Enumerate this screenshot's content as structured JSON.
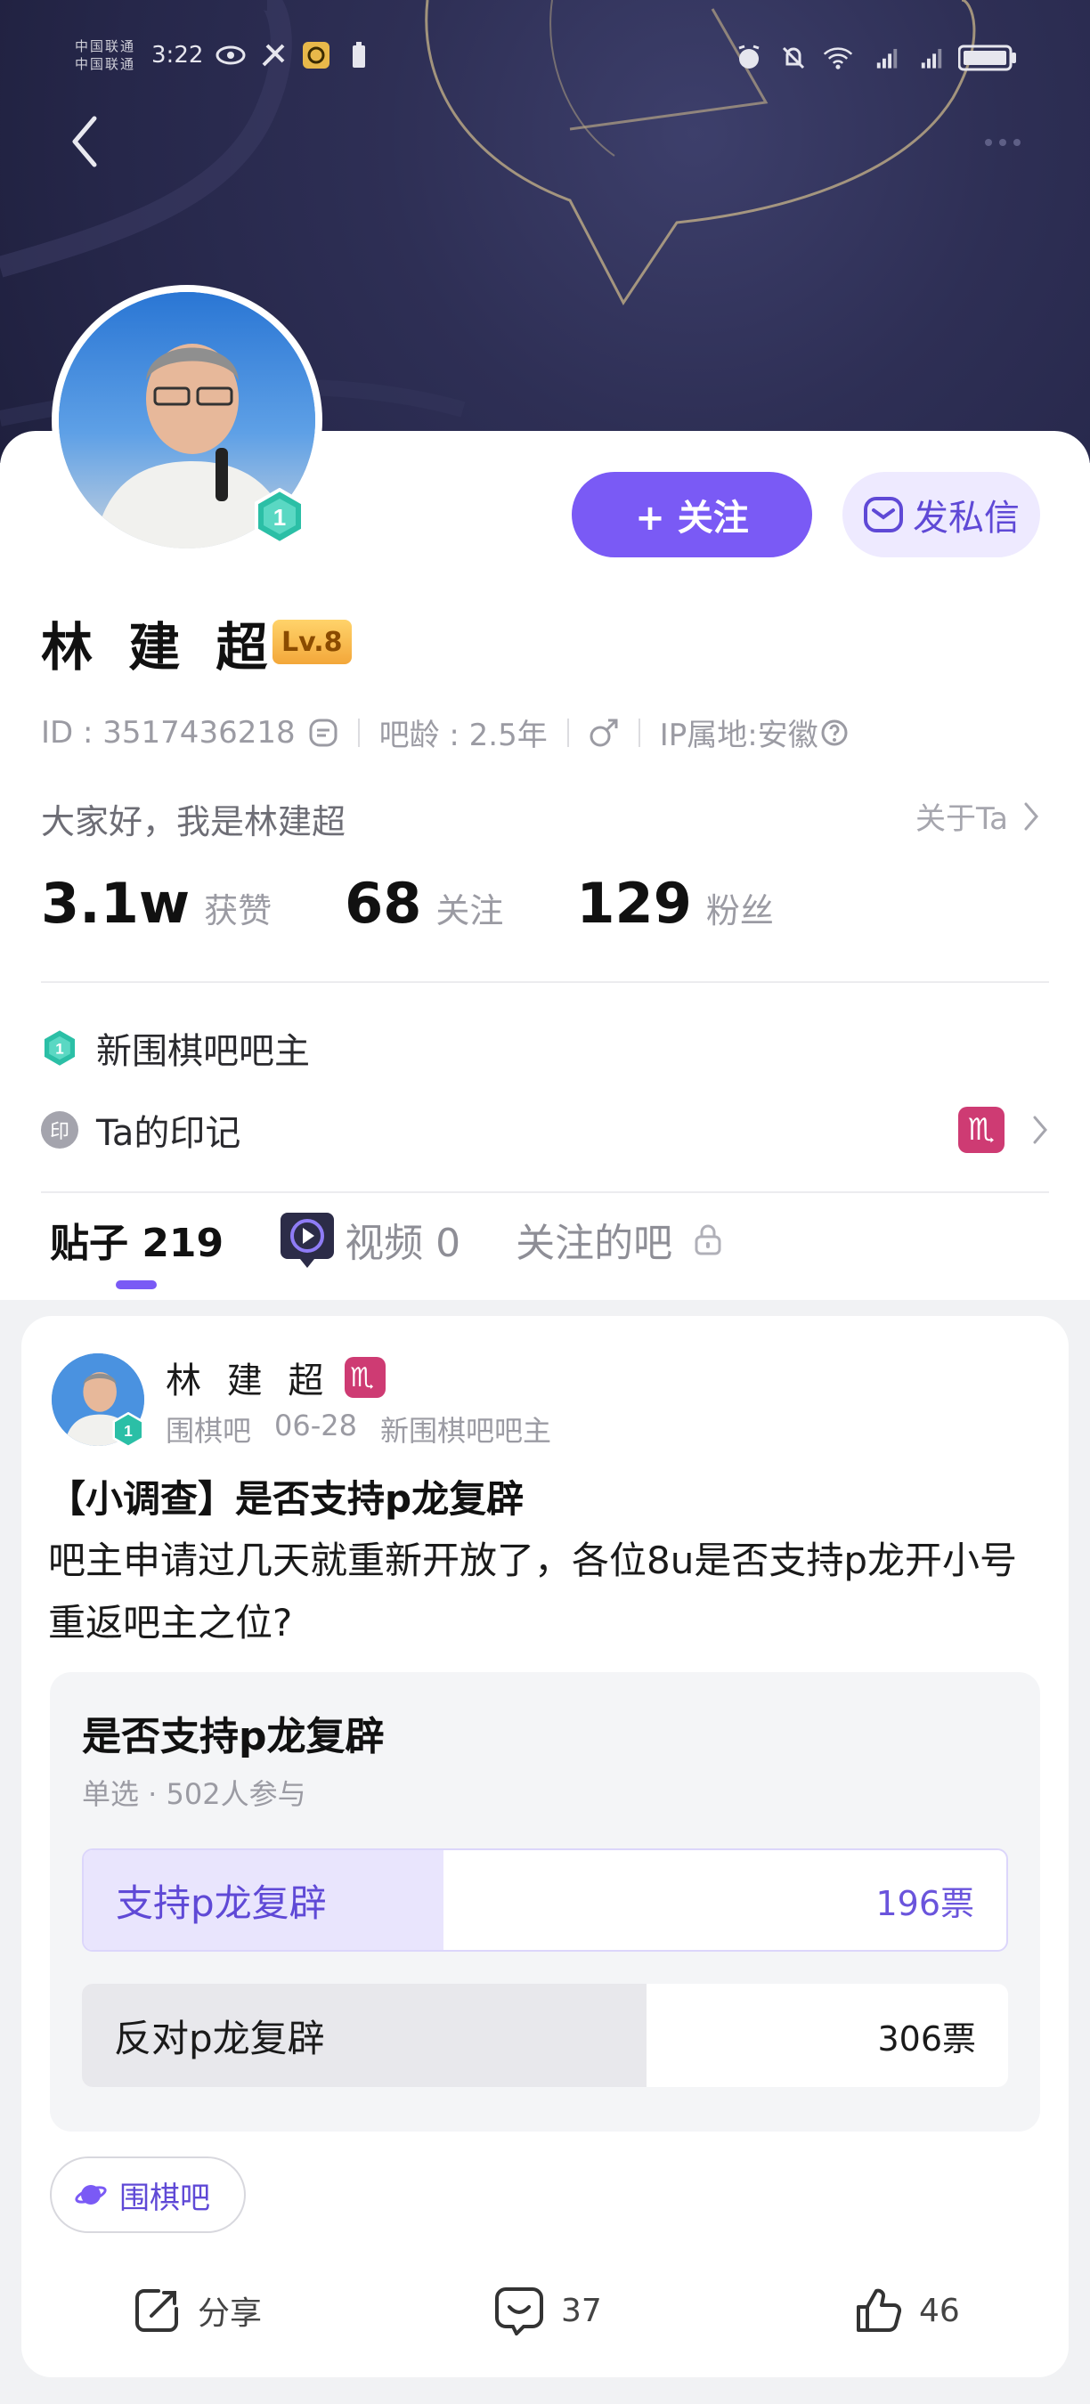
{
  "status_bar": {
    "carrier_1": "中国联通",
    "carrier_2": "中国联通",
    "time": "3:22",
    "battery": "100"
  },
  "profile": {
    "name": "林 建 超",
    "level": "Lv.8",
    "id_text": "ID : 3517436218",
    "age_text": "吧龄 : 2.5年",
    "ip_text": "IP属地:安徽",
    "intro": "大家好，我是林建超",
    "about_link": "关于Ta",
    "follow_label": "+ 关注",
    "dm_label": "发私信",
    "avatar_badge_number": "1",
    "stats": [
      {
        "num": "3.1w",
        "label": "获赞"
      },
      {
        "num": "68",
        "label": "关注"
      },
      {
        "num": "129",
        "label": "粉丝"
      }
    ],
    "role": "新围棋吧吧主",
    "mark_label": "Ta的印记",
    "mark_icon_char": "印"
  },
  "tabs": [
    {
      "label": "贴子 219"
    },
    {
      "label": "视频 0"
    },
    {
      "label": "关注的吧"
    }
  ],
  "post": {
    "author": "林 建 超",
    "forum": "围棋吧",
    "date": "06-28",
    "role": "新围棋吧吧主",
    "title": "【小调查】是否支持p龙复辟",
    "body": "吧主申请过几天就重新开放了，各位8u是否支持p龙开小号重返吧主之位?",
    "poll": {
      "title": "是否支持p龙复辟",
      "subtitle": "单选 · 502人参与",
      "options": [
        {
          "label": "支持p龙复辟",
          "votes": "196票",
          "fraction": 0.39
        },
        {
          "label": "反对p龙复辟",
          "votes": "306票",
          "fraction": 0.61
        }
      ]
    },
    "forum_chip": "围棋吧",
    "actions": {
      "share": "分享",
      "comments": "37",
      "likes": "46"
    }
  },
  "colors": {
    "accent": "#7a5af5",
    "banner": "#2e2f55",
    "mark_badge": "#ce3b73"
  }
}
